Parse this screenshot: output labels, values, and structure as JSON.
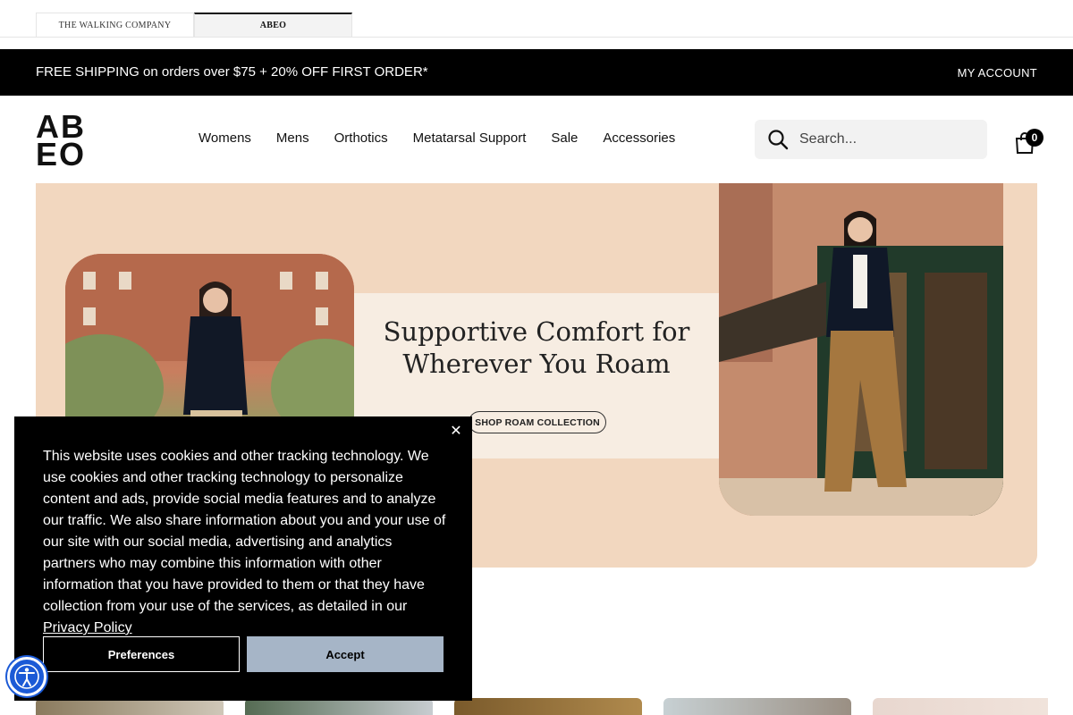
{
  "brand_tabs": [
    {
      "label": "THE WALKING COMPANY"
    },
    {
      "label": "ABEO"
    }
  ],
  "promo": {
    "text": "FREE SHIPPING on orders over $75 + 20% OFF FIRST ORDER*",
    "account": "MY ACCOUNT"
  },
  "logo": {
    "top": "AB",
    "bottom": "EO"
  },
  "nav": [
    {
      "label": "Womens"
    },
    {
      "label": "Mens"
    },
    {
      "label": "Orthotics"
    },
    {
      "label": "Metatarsal Support"
    },
    {
      "label": "Sale"
    },
    {
      "label": "Accessories"
    }
  ],
  "search": {
    "placeholder": "Search..."
  },
  "cart": {
    "count": "0"
  },
  "hero": {
    "title_line1": "Supportive Comfort for",
    "title_line2": "Wherever You Roam",
    "cta": "SHOP ROAM COLLECTION"
  },
  "cookie": {
    "text": "This website uses cookies and other tracking technology. We use cookies and other tracking technology to personalize content and ads, provide social media features and to analyze our traffic. We also share information about you and your use of our site with our social media, advertising and analytics partners who may combine this information with other information that you have provided to them or that they have collection from your use of the services, as detailed in our ",
    "link": "Privacy Policy",
    "preferences": "Preferences",
    "accept": "Accept"
  },
  "colors": {
    "promo_bg": "#000000",
    "hero_bg": "#f2d7bf",
    "accept_bg": "#a6b5c7",
    "a11y_blue": "#1b5ad6"
  }
}
